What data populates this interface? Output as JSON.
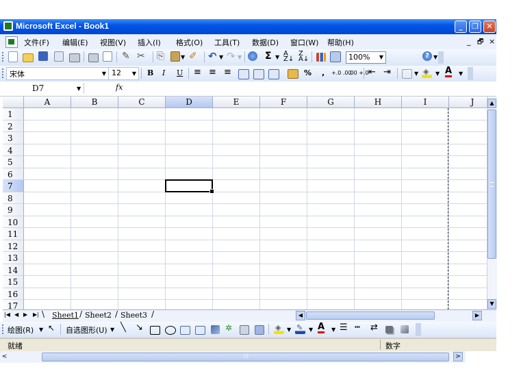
{
  "window": {
    "title": "Microsoft Excel - Book1",
    "controls": {
      "minimize": "_",
      "restore": "❐",
      "close": "✕"
    }
  },
  "menu": {
    "items": [
      {
        "label": "文件(F)"
      },
      {
        "label": "编辑(E)"
      },
      {
        "label": "视图(V)"
      },
      {
        "label": "插入(I)"
      },
      {
        "label": "格式(O)"
      },
      {
        "label": "工具(T)"
      },
      {
        "label": "数据(D)"
      },
      {
        "label": "窗口(W)"
      },
      {
        "label": "帮助(H)"
      }
    ],
    "doc_controls": {
      "minimize": "_",
      "restore": "🗗",
      "close": "×"
    }
  },
  "standard_toolbar": {
    "zoom": "100%",
    "icons": [
      "new-icon",
      "open-icon",
      "save-icon",
      "permission-icon",
      "print-icon",
      "print-preview-icon",
      "spelling-icon",
      "research-icon",
      "cut-icon",
      "copy-icon",
      "paste-icon",
      "format-painter-icon",
      "undo-icon",
      "redo-icon",
      "hyperlink-icon",
      "autosum-icon",
      "sort-ascending-icon",
      "sort-descending-icon",
      "chart-wizard-icon",
      "drawing-icon",
      "help-icon"
    ],
    "sigma": "Σ"
  },
  "format_toolbar": {
    "font": "宋体",
    "size": "12",
    "bold": "B",
    "italic": "I",
    "underline": "U",
    "percent": "%",
    "comma": ",",
    "increase_decimal": "+.0 .00",
    "decrease_decimal": ".00 +.0",
    "font_color_letter": "A"
  },
  "formula_bar": {
    "name_box": "D7",
    "fx": "fx"
  },
  "grid": {
    "columns": [
      "A",
      "B",
      "C",
      "D",
      "E",
      "F",
      "G",
      "H",
      "I",
      "J"
    ],
    "rows": [
      "1",
      "2",
      "3",
      "4",
      "5",
      "6",
      "7",
      "8",
      "9",
      "10",
      "11",
      "12",
      "13",
      "14",
      "15",
      "16",
      "17"
    ],
    "selected_cell": "D7",
    "selected_column": "D",
    "selected_row": "7"
  },
  "sheets": {
    "tabs": [
      "Sheet1",
      "Sheet2",
      "Sheet3"
    ],
    "active": "Sheet1",
    "nav": [
      "|◀",
      "◀",
      "▶",
      "▶|"
    ]
  },
  "drawing_toolbar": {
    "draw_label": "绘图(R)",
    "autoshapes_label": "自选图形(U)"
  },
  "status": {
    "left": "就绪",
    "right": "数字"
  },
  "colors": {
    "title_bar": "#0055e5",
    "menu_bg": "#eaf1fc",
    "status_bg": "#ece9d8",
    "selected_header": "#b4c8f0"
  }
}
